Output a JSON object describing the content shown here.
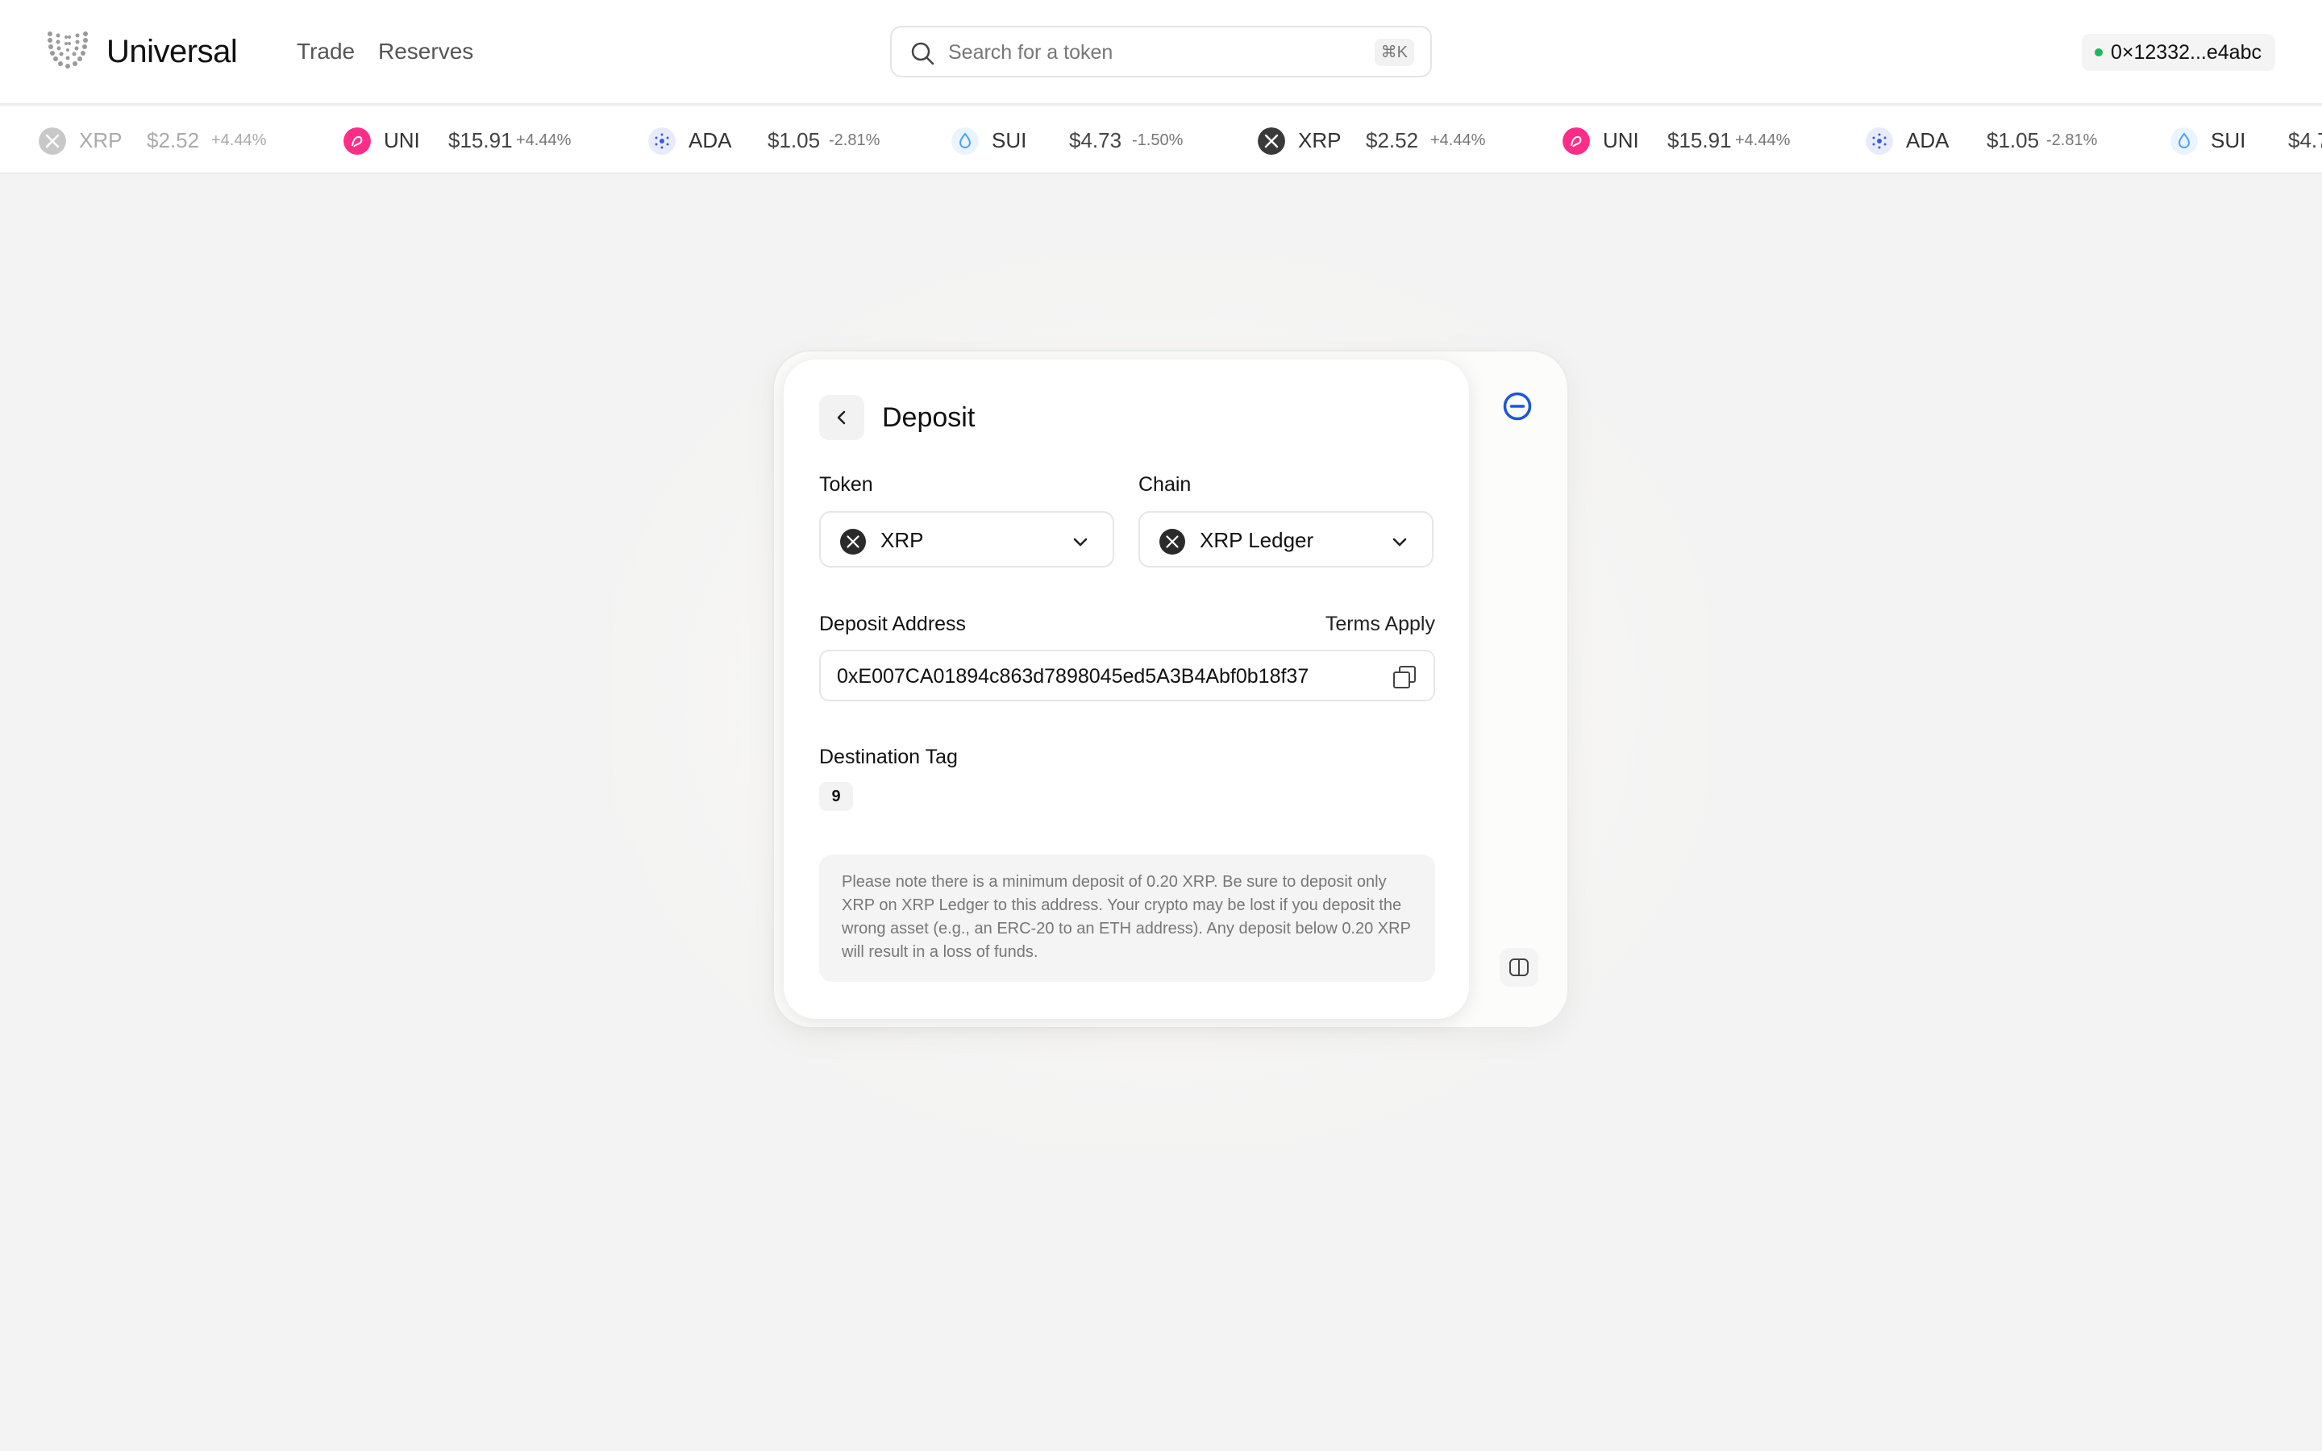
{
  "header": {
    "brand": "Universal",
    "nav": {
      "trade": "Trade",
      "reserves": "Reserves"
    },
    "search": {
      "placeholder": "Search for a token",
      "shortcut": "⌘K"
    },
    "wallet": {
      "address": "0×12332...e4abc",
      "status_color": "#1fb75b"
    }
  },
  "ticker": [
    {
      "symbol": "XRP",
      "price": "$2.52",
      "change": "+4.44%",
      "icon": "xrp-icon"
    },
    {
      "symbol": "UNI",
      "price": "$15.91",
      "change": "+4.44%",
      "icon": "uni-icon"
    },
    {
      "symbol": "ADA",
      "price": "$1.05",
      "change": "-2.81%",
      "icon": "ada-icon"
    },
    {
      "symbol": "SUI",
      "price": "$4.73",
      "change": "-1.50%",
      "icon": "sui-icon"
    },
    {
      "symbol": "XRP",
      "price": "$2.52",
      "change": "+4.44%",
      "icon": "xrp-icon"
    },
    {
      "symbol": "UNI",
      "price": "$15.91",
      "change": "+4.44%",
      "icon": "uni-icon"
    },
    {
      "symbol": "ADA",
      "price": "$1.05",
      "change": "-2.81%",
      "icon": "ada-icon"
    },
    {
      "symbol": "SUI",
      "price": "$4.7",
      "change": "",
      "icon": "sui-icon"
    }
  ],
  "deposit": {
    "title": "Deposit",
    "token_label": "Token",
    "token_value": "XRP",
    "chain_label": "Chain",
    "chain_value": "XRP Ledger",
    "address_label": "Deposit Address",
    "terms_link": "Terms Apply",
    "address": "0xE007CA01894c863d7898045ed5A3B4Abf0b18f37",
    "tag_label": "Destination Tag",
    "tag_value": "9",
    "notice": "Please note there is a minimum deposit of 0.20 XRP. Be sure to deposit only XRP on XRP Ledger to this address. Your crypto may be lost if you deposit the wrong asset (e.g., an ERC-20 to an ETH address). Any deposit below 0.20 XRP will result in a loss of funds."
  },
  "colors": {
    "accent_blue": "#1a56db",
    "uni_pink": "#ff2d87",
    "ada_blue": "#3b5bdb",
    "sui_blue": "#4da2ff"
  }
}
